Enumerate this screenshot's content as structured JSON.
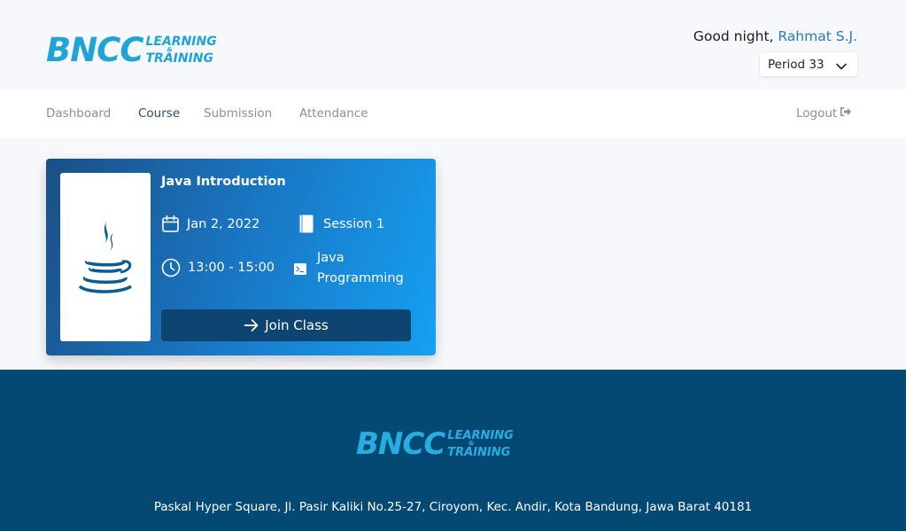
{
  "header": {
    "logo": {
      "main": "BNCC",
      "line1": "LEARNING",
      "amp": "&",
      "line2": "TRAINING"
    },
    "greeting": "Good night, ",
    "user_name": "Rahmat S.J.",
    "period": "Period 33"
  },
  "nav": {
    "items": [
      "Dashboard",
      "Course",
      "Submission",
      "Attendance"
    ],
    "active": "Course",
    "logout": "Logout"
  },
  "course_card": {
    "title": "Java Introduction",
    "date": "Jan 2, 2022",
    "session": "Session 1",
    "time": "13:00 - 15:00",
    "subject_line1": "Java",
    "subject_line2": "Programming",
    "join_label": "Join Class",
    "icons": [
      "java-logo-icon",
      "calendar-icon",
      "book-icon",
      "clock-icon",
      "terminal-icon",
      "arrow-right-icon"
    ]
  },
  "footer": {
    "logo": {
      "main": "BNCC",
      "line1": "LEARNING",
      "amp": "&",
      "line2": "TRAINING"
    },
    "address": "Paskal Hyper Square, Jl. Pasir Kaliki No.25-27, Ciroyom, Kec. Andir, Kota Bandung, Jawa Barat 40181"
  },
  "colors": {
    "brand": "#1fa4d6",
    "user_link": "#2b7bb9",
    "footer_bg": "#044874",
    "button_bg": "#0e4470"
  }
}
